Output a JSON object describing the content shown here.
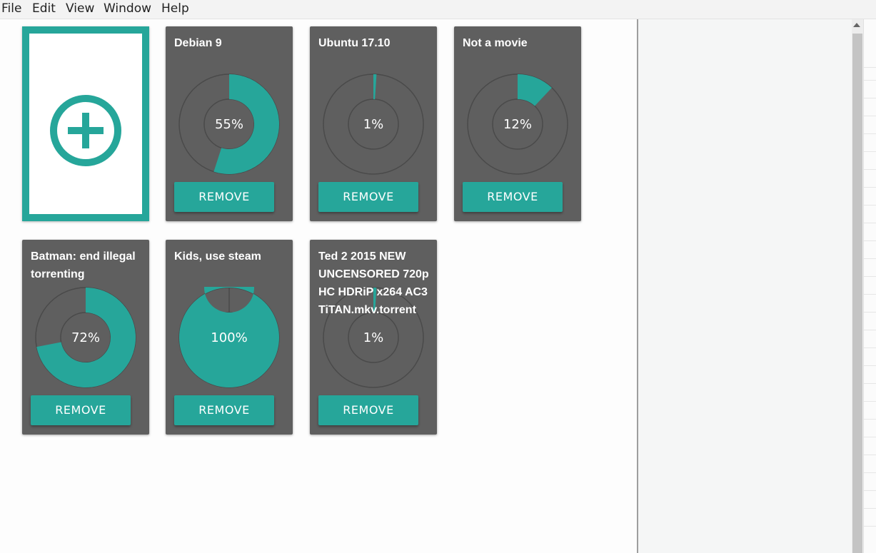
{
  "menu": {
    "items": [
      "File",
      "Edit",
      "View",
      "Window",
      "Help"
    ]
  },
  "colors": {
    "accent": "#26a69a",
    "card_bg": "#5f5f5f",
    "track": "#4a4a4a"
  },
  "add_card": {
    "icon": "plus-circle-icon"
  },
  "torrents": [
    {
      "name": "Debian 9",
      "percent": 55,
      "label": "55%",
      "button": "REMOVE"
    },
    {
      "name": "Ubuntu 17.10",
      "percent": 1,
      "label": "1%",
      "button": "REMOVE"
    },
    {
      "name": "Not a movie",
      "percent": 12,
      "label": "12%",
      "button": "REMOVE"
    },
    {
      "name": "Batman: end illegal torrenting",
      "percent": 72,
      "label": "72%",
      "button": "REMOVE"
    },
    {
      "name": "Kids, use steam",
      "percent": 100,
      "label": "100%",
      "button": "REMOVE"
    },
    {
      "name": "Ted 2 2015 NEW UNCENSORED 720p HC HDRiP x264 AC3 TiTAN.mkv.torrent",
      "percent": 1,
      "label": "1%",
      "button": "REMOVE"
    }
  ]
}
